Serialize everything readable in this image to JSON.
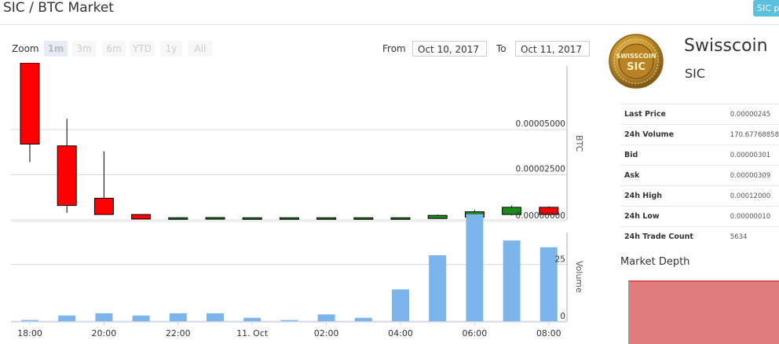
{
  "page": {
    "title": "SIC / BTC Market",
    "tag": "SIC p"
  },
  "toolbar": {
    "zoom_label": "Zoom",
    "zoom_buttons": [
      "1m",
      "3m",
      "6m",
      "YTD",
      "1y",
      "All"
    ],
    "active_zoom": "1m",
    "from_label": "From",
    "from_value": "Oct 10, 2017",
    "to_label": "To",
    "to_value": "Oct 11, 2017"
  },
  "coin": {
    "name": "Swisscoin",
    "symbol": "SIC",
    "logo_text": "SWISSCOIN",
    "logo_sub": "SIC"
  },
  "stats": [
    {
      "label": "Last Price",
      "value": "0.00000245"
    },
    {
      "label": "24h Volume",
      "value": "170.67768858"
    },
    {
      "label": "Bid",
      "value": "0.00000301"
    },
    {
      "label": "Ask",
      "value": "0.00000309"
    },
    {
      "label": "24h High",
      "value": "0.00012000"
    },
    {
      "label": "24h Low",
      "value": "0.00000010"
    },
    {
      "label": "24h Trade Count",
      "value": "5634"
    }
  ],
  "depth": {
    "title": "Market Depth"
  },
  "colors": {
    "up": "#1a8a1a",
    "down": "#ff0000",
    "volume": "#7cb5ec",
    "depth": "#e17b7b"
  },
  "chart_data": {
    "type": "candlestick",
    "price_axis": {
      "label": "BTC",
      "ticks": [
        "0.00005000",
        "0.00002500",
        "0.00000000"
      ],
      "tick_values": [
        5e-05,
        2.5e-05,
        0
      ],
      "ylim": [
        0,
        8.7e-05
      ]
    },
    "volume_axis": {
      "label": "Volume",
      "ticks": [
        "25",
        "0"
      ],
      "tick_values": [
        25,
        0
      ],
      "ylim": [
        0,
        39
      ]
    },
    "x_ticks": [
      "18:00",
      "20:00",
      "22:00",
      "11. Oct",
      "02:00",
      "04:00",
      "06:00",
      "08:00"
    ],
    "candles": [
      {
        "open": 8.7e-05,
        "high": 8.7e-05,
        "low": 3.2e-05,
        "close": 4.2e-05
      },
      {
        "open": 4.1e-05,
        "high": 5.6e-05,
        "low": 4e-06,
        "close": 8e-06
      },
      {
        "open": 1.2e-05,
        "high": 3.8e-05,
        "low": 3e-06,
        "close": 3e-06
      },
      {
        "open": 3e-06,
        "high": 3e-06,
        "low": 5e-07,
        "close": 5e-07
      },
      {
        "open": 5e-07,
        "high": 1.5e-06,
        "low": 3e-07,
        "close": 1.2e-06
      },
      {
        "open": 8e-07,
        "high": 1.5e-06,
        "low": 6e-07,
        "close": 1.3e-06
      },
      {
        "open": 1.1e-06,
        "high": 1.3e-06,
        "low": 1e-06,
        "close": 1.2e-06
      },
      {
        "open": 1.1e-06,
        "high": 1.3e-06,
        "low": 1e-06,
        "close": 1.2e-06
      },
      {
        "open": 1.1e-06,
        "high": 1.3e-06,
        "low": 1e-06,
        "close": 1.2e-06
      },
      {
        "open": 1.1e-06,
        "high": 1.3e-06,
        "low": 1e-06,
        "close": 1.2e-06
      },
      {
        "open": 1.1e-06,
        "high": 1.3e-06,
        "low": 1e-06,
        "close": 1.2e-06
      },
      {
        "open": 8e-07,
        "high": 3e-06,
        "low": 7e-07,
        "close": 2.5e-06
      },
      {
        "open": 1.5e-06,
        "high": 5.5e-06,
        "low": 1.2e-06,
        "close": 4.5e-06
      },
      {
        "open": 3e-06,
        "high": 8e-06,
        "low": 2.5e-06,
        "close": 7e-06
      },
      {
        "open": 7e-06,
        "high": 7.5e-06,
        "low": 2.5e-06,
        "close": 3e-06
      }
    ],
    "volume": [
      0.5,
      2.5,
      3.5,
      2.5,
      3.5,
      3.5,
      1.5,
      0.5,
      3.0,
      1.5,
      14.0,
      29.0,
      47.0,
      35.5,
      32.5
    ]
  }
}
